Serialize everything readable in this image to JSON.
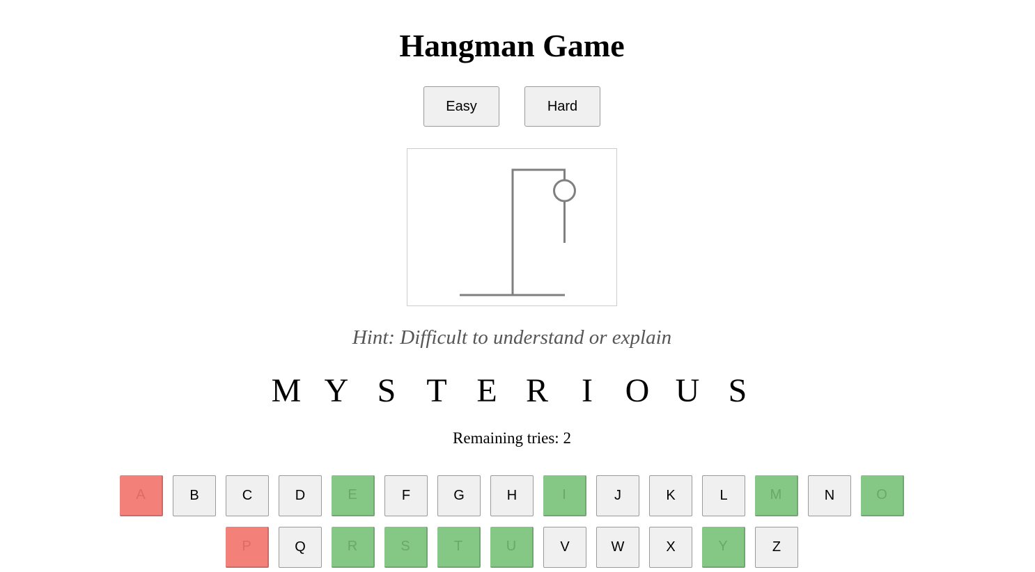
{
  "title": "Hangman Game",
  "difficulty": {
    "easy_label": "Easy",
    "hard_label": "Hard"
  },
  "hint": "Hint: Difficult to understand or explain",
  "word_letters": [
    "M",
    "Y",
    "S",
    "T",
    "E",
    "R",
    "I",
    "O",
    "U",
    "S"
  ],
  "remaining_tries_text": "Remaining tries: 2",
  "remaining_tries": 2,
  "colors": {
    "correct_key": "#85c785",
    "wrong_key": "#f4807a",
    "default_key": "#f0f0f0",
    "gallows_stroke": "#808080"
  },
  "keyboard": {
    "row1": [
      {
        "letter": "A",
        "state": "wrong"
      },
      {
        "letter": "B",
        "state": "unused"
      },
      {
        "letter": "C",
        "state": "unused"
      },
      {
        "letter": "D",
        "state": "unused"
      },
      {
        "letter": "E",
        "state": "correct"
      },
      {
        "letter": "F",
        "state": "unused"
      },
      {
        "letter": "G",
        "state": "unused"
      },
      {
        "letter": "H",
        "state": "unused"
      },
      {
        "letter": "I",
        "state": "correct"
      },
      {
        "letter": "J",
        "state": "unused"
      },
      {
        "letter": "K",
        "state": "unused"
      },
      {
        "letter": "L",
        "state": "unused"
      },
      {
        "letter": "M",
        "state": "correct"
      },
      {
        "letter": "N",
        "state": "unused"
      },
      {
        "letter": "O",
        "state": "correct"
      }
    ],
    "row2": [
      {
        "letter": "P",
        "state": "wrong"
      },
      {
        "letter": "Q",
        "state": "unused"
      },
      {
        "letter": "R",
        "state": "correct"
      },
      {
        "letter": "S",
        "state": "correct"
      },
      {
        "letter": "T",
        "state": "correct"
      },
      {
        "letter": "U",
        "state": "correct"
      },
      {
        "letter": "V",
        "state": "unused"
      },
      {
        "letter": "W",
        "state": "unused"
      },
      {
        "letter": "X",
        "state": "unused"
      },
      {
        "letter": "Y",
        "state": "correct"
      },
      {
        "letter": "Z",
        "state": "unused"
      }
    ]
  }
}
